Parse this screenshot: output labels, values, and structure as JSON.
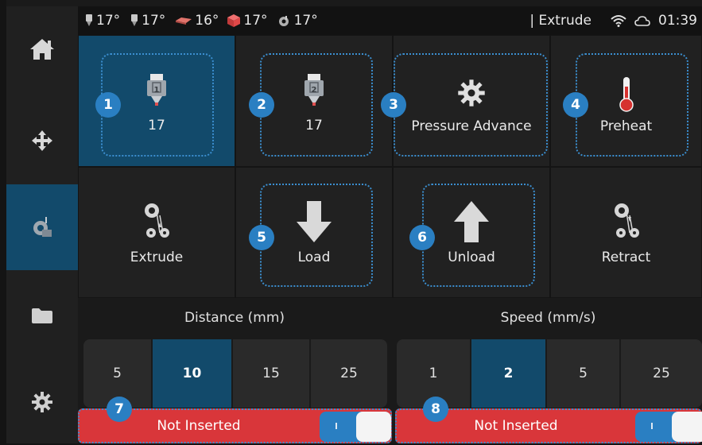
{
  "status_bar": {
    "temps": [
      {
        "icon": "nozzle-1-icon",
        "value": "17°"
      },
      {
        "icon": "nozzle-2-icon",
        "value": "17°"
      },
      {
        "icon": "heated-bed-icon",
        "value": "16°"
      },
      {
        "icon": "chamber-icon",
        "value": "17°"
      },
      {
        "icon": "fan-icon",
        "value": "17°"
      }
    ],
    "screen_title": "| Extrude",
    "time": "01:39"
  },
  "sidebar": {
    "items": [
      {
        "name": "home",
        "icon": "home-icon"
      },
      {
        "name": "move",
        "icon": "move-arrows-icon"
      },
      {
        "name": "extrude",
        "icon": "extruder-icon",
        "active": true
      },
      {
        "name": "files",
        "icon": "folder-icon"
      },
      {
        "name": "settings",
        "icon": "gear-icon"
      }
    ]
  },
  "tiles": {
    "tool1": {
      "label": "17",
      "badge": "1",
      "number": "1"
    },
    "tool2": {
      "label": "17",
      "badge": "2",
      "number": "2"
    },
    "pressure_advance": {
      "label": "Pressure Advance",
      "badge": "3"
    },
    "preheat": {
      "label": "Preheat",
      "badge": "4"
    },
    "extrude": {
      "label": "Extrude"
    },
    "load": {
      "label": "Load",
      "badge": "5"
    },
    "unload": {
      "label": "Unload",
      "badge": "6"
    },
    "retract": {
      "label": "Retract"
    }
  },
  "distance": {
    "header": "Distance (mm)",
    "options": [
      "5",
      "10",
      "15",
      "25"
    ],
    "selected": "10"
  },
  "speed": {
    "header": "Speed (mm/s)",
    "options": [
      "1",
      "2",
      "5",
      "25"
    ],
    "selected": "2"
  },
  "filament_sensors": [
    {
      "label": "Not Inserted",
      "badge": "7"
    },
    {
      "label": "Not Inserted",
      "badge": "8"
    }
  ],
  "colors": {
    "accent": "#2a7fc2",
    "selected_bg": "#124a6b",
    "alert_red": "#d9363a"
  }
}
